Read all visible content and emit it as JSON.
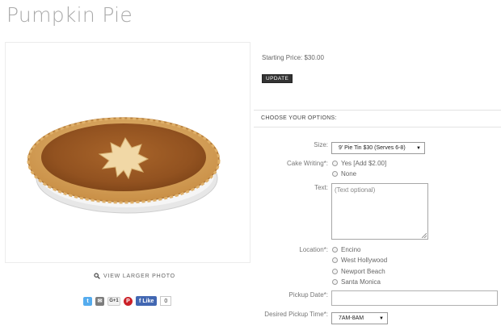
{
  "product": {
    "title": "Pumpkin Pie"
  },
  "gallery": {
    "view_larger": "VIEW LARGER PHOTO"
  },
  "share": {
    "like_label": "Like",
    "like_count": "0",
    "gplus_label": "G+1"
  },
  "pricing": {
    "starting_price": "Starting Price: $30.00",
    "update_label": "UPDATE"
  },
  "options": {
    "heading": "CHOOSE YOUR OPTIONS:",
    "size": {
      "label": "Size:",
      "value": "9' Pie Tin $30 (Serves 6-8)"
    },
    "cake_writing": {
      "label": "Cake Writing*:",
      "options": [
        "Yes [Add $2.00]",
        "None"
      ]
    },
    "text": {
      "label": "Text:",
      "placeholder": "(Text optional)"
    },
    "location": {
      "label": "Location*:",
      "options": [
        "Encino",
        "West Hollywood",
        "Newport Beach",
        "Santa Monica"
      ]
    },
    "pickup_date": {
      "label": "Pickup Date*:",
      "value": ""
    },
    "pickup_time": {
      "label": "Desired Pickup Time*:",
      "value": "7AM-8AM"
    }
  },
  "colors": {
    "twitter": "#55acee",
    "email": "#7d7d7d",
    "pinterest": "#cb2027",
    "facebook": "#4267b2",
    "pie_fill": "#9c5822",
    "crust": "#d9a863"
  }
}
